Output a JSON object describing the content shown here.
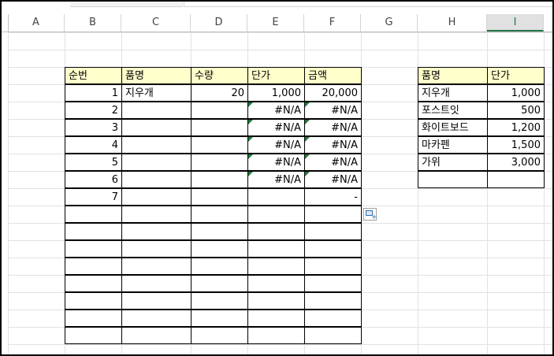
{
  "columns": [
    "A",
    "B",
    "C",
    "D",
    "E",
    "F",
    "G",
    "H",
    "I"
  ],
  "selected_column": "I",
  "main_table": {
    "headers": [
      "순번",
      "품명",
      "수량",
      "단가",
      "금액"
    ],
    "rows": [
      [
        "1",
        "지우개",
        "20",
        "1,000",
        "20,000"
      ],
      [
        "2",
        "",
        "",
        "#N/A",
        "#N/A"
      ],
      [
        "3",
        "",
        "",
        "#N/A",
        "#N/A"
      ],
      [
        "4",
        "",
        "",
        "#N/A",
        "#N/A"
      ],
      [
        "5",
        "",
        "",
        "#N/A",
        "#N/A"
      ],
      [
        "6",
        "",
        "",
        "#N/A",
        "#N/A"
      ],
      [
        "7",
        "",
        "",
        "",
        "-"
      ]
    ],
    "empty_rows": 8
  },
  "lookup_table": {
    "headers": [
      "품명",
      "단가"
    ],
    "rows": [
      [
        "지우개",
        "1,000"
      ],
      [
        "포스트잇",
        "500"
      ],
      [
        "화이트보드",
        "1,200"
      ],
      [
        "마카펜",
        "1,500"
      ],
      [
        "가위",
        "3,000"
      ],
      [
        "",
        ""
      ]
    ]
  },
  "colors": {
    "header_fill": "#ffffcc",
    "error_indicator": "#1e7b3c",
    "selected_header": "#217346"
  },
  "icons": {
    "paste_options": "paste-options-icon"
  }
}
